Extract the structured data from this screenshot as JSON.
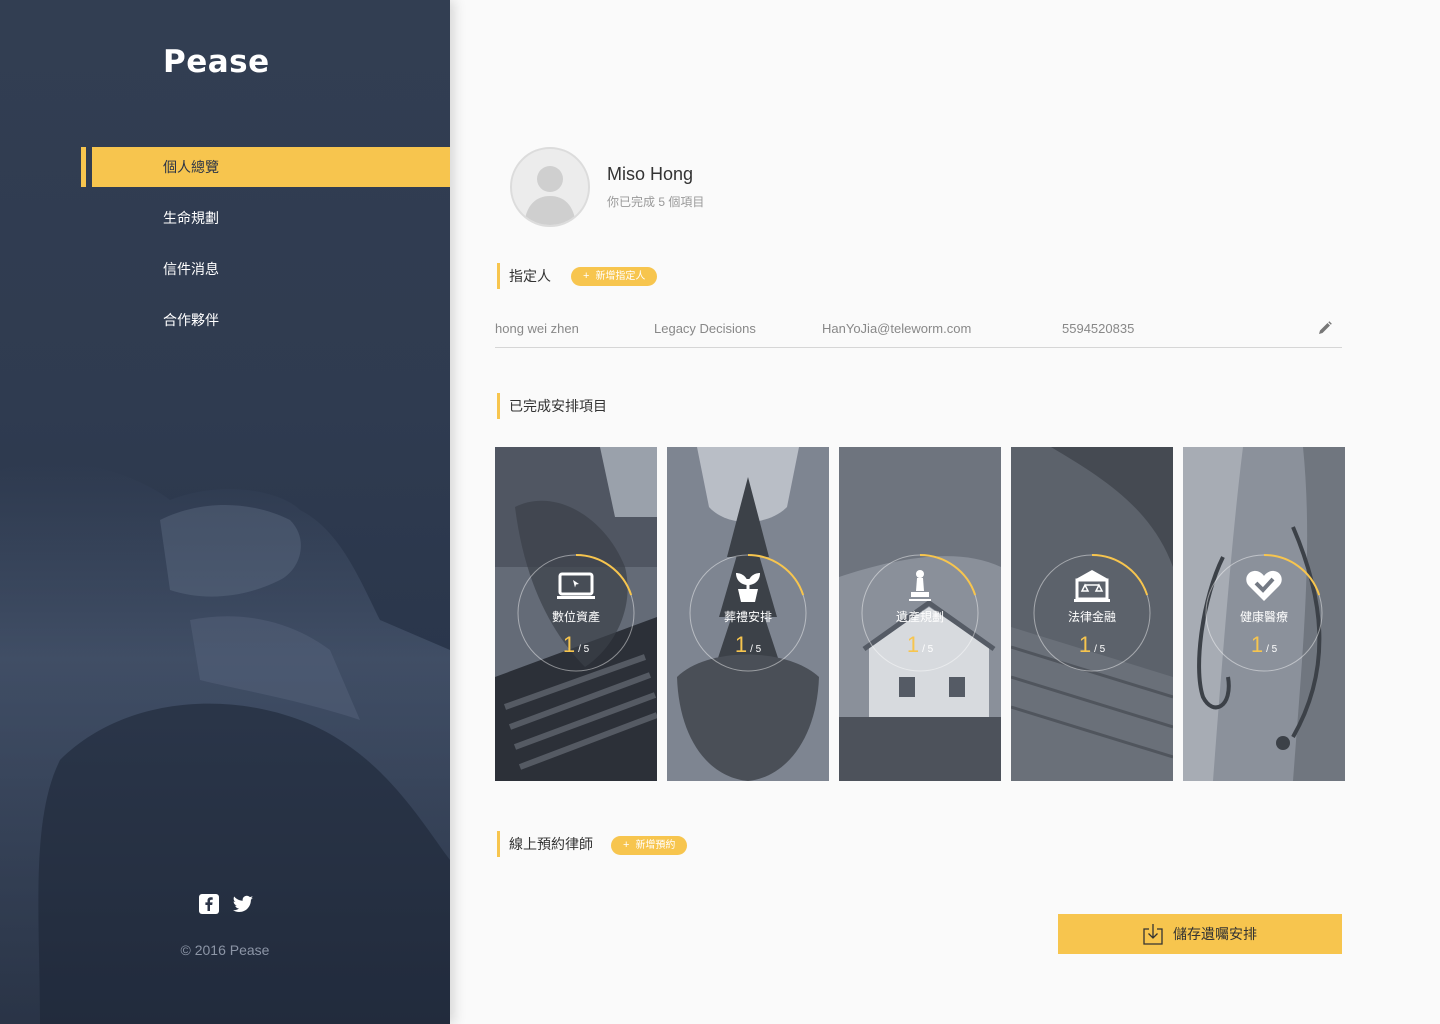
{
  "sidebar": {
    "logo": "Pease",
    "nav": [
      {
        "label": "個人總覽",
        "active": true
      },
      {
        "label": "生命規劃",
        "active": false
      },
      {
        "label": "信件消息",
        "active": false
      },
      {
        "label": "合作夥伴",
        "active": false
      }
    ],
    "social_icons": [
      "facebook-icon",
      "twitter-icon"
    ],
    "copyright": "© 2016 Pease"
  },
  "profile": {
    "name": "Miso Hong",
    "subtitle": "你已完成 5 個項目"
  },
  "designee": {
    "title": "指定人",
    "add_label": "新增指定人",
    "contact": {
      "name": "hong wei zhen",
      "company": "Legacy Decisions",
      "email": "HanYoJia@teleworm.com",
      "phone": "5594520835"
    }
  },
  "completed": {
    "title": "已完成安排項目",
    "cards": [
      {
        "label": "數位資產",
        "done": "1",
        "total": "/ 5",
        "progress": 0.2,
        "icon": "laptop-icon"
      },
      {
        "label": "葬禮安排",
        "done": "1",
        "total": "/ 5",
        "progress": 0.2,
        "icon": "plant-icon"
      },
      {
        "label": "遺產規劃",
        "done": "1",
        "total": "/ 5",
        "progress": 0.2,
        "icon": "stamp-icon"
      },
      {
        "label": "法律金融",
        "done": "1",
        "total": "/ 5",
        "progress": 0.2,
        "icon": "bank-icon"
      },
      {
        "label": "健康醫療",
        "done": "1",
        "total": "/ 5",
        "progress": 0.2,
        "icon": "heart-icon"
      }
    ]
  },
  "lawyer": {
    "title": "線上預約律師",
    "add_label": "新增預約"
  },
  "save_button": "儲存遺囑安排",
  "colors": {
    "accent": "#f7c54e",
    "sidebar": "#2f3b50",
    "background": "#fafafa"
  }
}
